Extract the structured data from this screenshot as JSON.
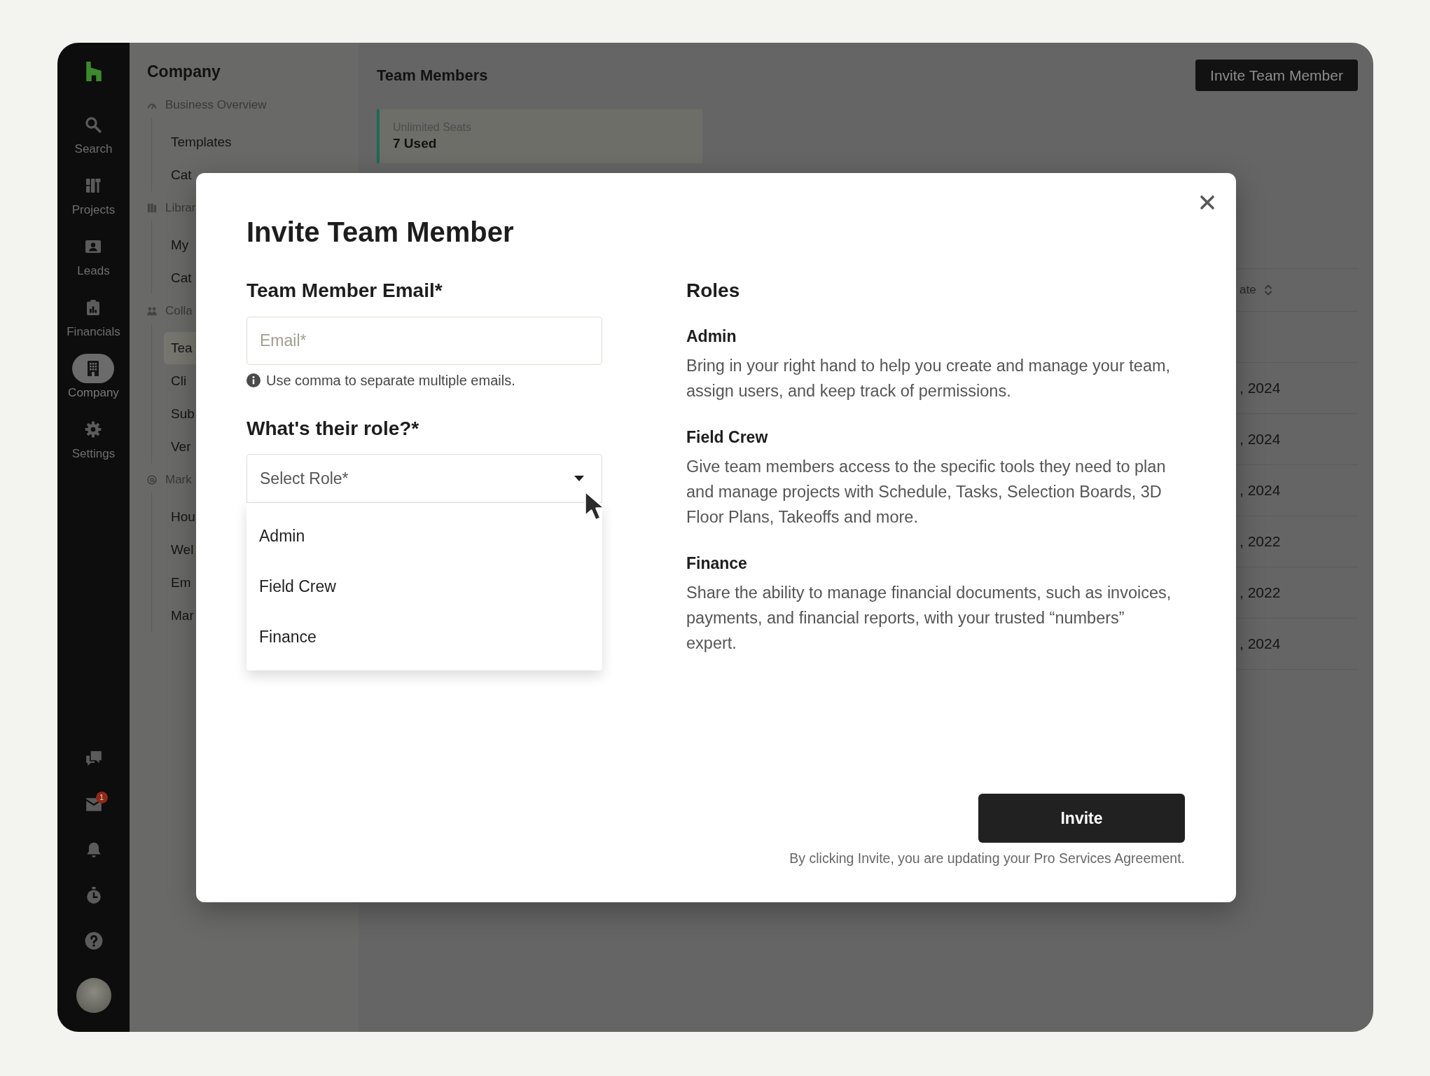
{
  "sidebar": {
    "items": [
      {
        "label": "Search",
        "selected": false
      },
      {
        "label": "Projects",
        "selected": false
      },
      {
        "label": "Leads",
        "selected": false
      },
      {
        "label": "Financials",
        "selected": false
      },
      {
        "label": "Company",
        "selected": true
      },
      {
        "label": "Settings",
        "selected": false
      }
    ],
    "inbox_badge": "1"
  },
  "nav": {
    "title": "Company",
    "sections": [
      {
        "label": "Business Overview",
        "children": [
          {
            "label": "Templates",
            "selected": false
          },
          {
            "label": "Cat",
            "selected": false
          }
        ]
      },
      {
        "label": "Librar",
        "children": [
          {
            "label": "My",
            "selected": false
          },
          {
            "label": "Cat",
            "selected": false
          }
        ]
      },
      {
        "label": "Colla",
        "children": [
          {
            "label": "Tea",
            "selected": true
          },
          {
            "label": "Cli",
            "selected": false
          },
          {
            "label": "Sub",
            "selected": false
          },
          {
            "label": "Ver",
            "selected": false
          }
        ]
      },
      {
        "label": "Mark",
        "children": [
          {
            "label": "Hou",
            "selected": false
          },
          {
            "label": "Wel",
            "selected": false
          },
          {
            "label": "Em",
            "selected": false
          },
          {
            "label": "Mar",
            "selected": false
          }
        ]
      }
    ]
  },
  "page": {
    "title": "Team Members",
    "action_button": "Invite Team Member",
    "seats_card": {
      "label": "Unlimited Seats",
      "value": "7 Used"
    },
    "table": {
      "columns": [
        {
          "label": "ate",
          "sortable": true
        }
      ],
      "rows": [
        {},
        {
          "cells": [
            ", 2024"
          ]
        },
        {
          "cells": [
            ", 2024"
          ]
        },
        {
          "cells": [
            ", 2024"
          ]
        },
        {
          "cells": [
            ", 2022"
          ]
        },
        {
          "cells": [
            ", 2022"
          ]
        },
        {
          "cells": [
            ", 2024"
          ]
        }
      ]
    }
  },
  "dialog": {
    "title": "Invite Team Member",
    "email": {
      "label": "Team Member Email*",
      "placeholder": "Email*",
      "hint": "Use comma to separate multiple emails."
    },
    "role": {
      "label": "What's their role?*",
      "placeholder": "Select Role*",
      "expanded": true,
      "options": [
        {
          "label": "Admin",
          "selected": false
        },
        {
          "label": "Field Crew",
          "selected": false
        },
        {
          "label": "Finance",
          "selected": false
        }
      ]
    },
    "roles_info": {
      "title": "Roles",
      "items": [
        {
          "name": "Admin",
          "description": "Bring in your right hand to help you create and manage your team, assign users, and keep track of permissions."
        },
        {
          "name": "Field Crew",
          "description": "Give team members access to the specific tools they need to plan and manage projects with Schedule, Tasks, Selection Boards, 3D Floor Plans, Takeoffs and more."
        },
        {
          "name": "Finance",
          "description": "Share the ability to manage financial documents, such as invoices, payments, and financial reports, with your trusted “numbers” expert."
        }
      ]
    },
    "submit_button": "Invite",
    "agreement_note": "By clicking Invite, you are updating your Pro Services Agreement."
  }
}
